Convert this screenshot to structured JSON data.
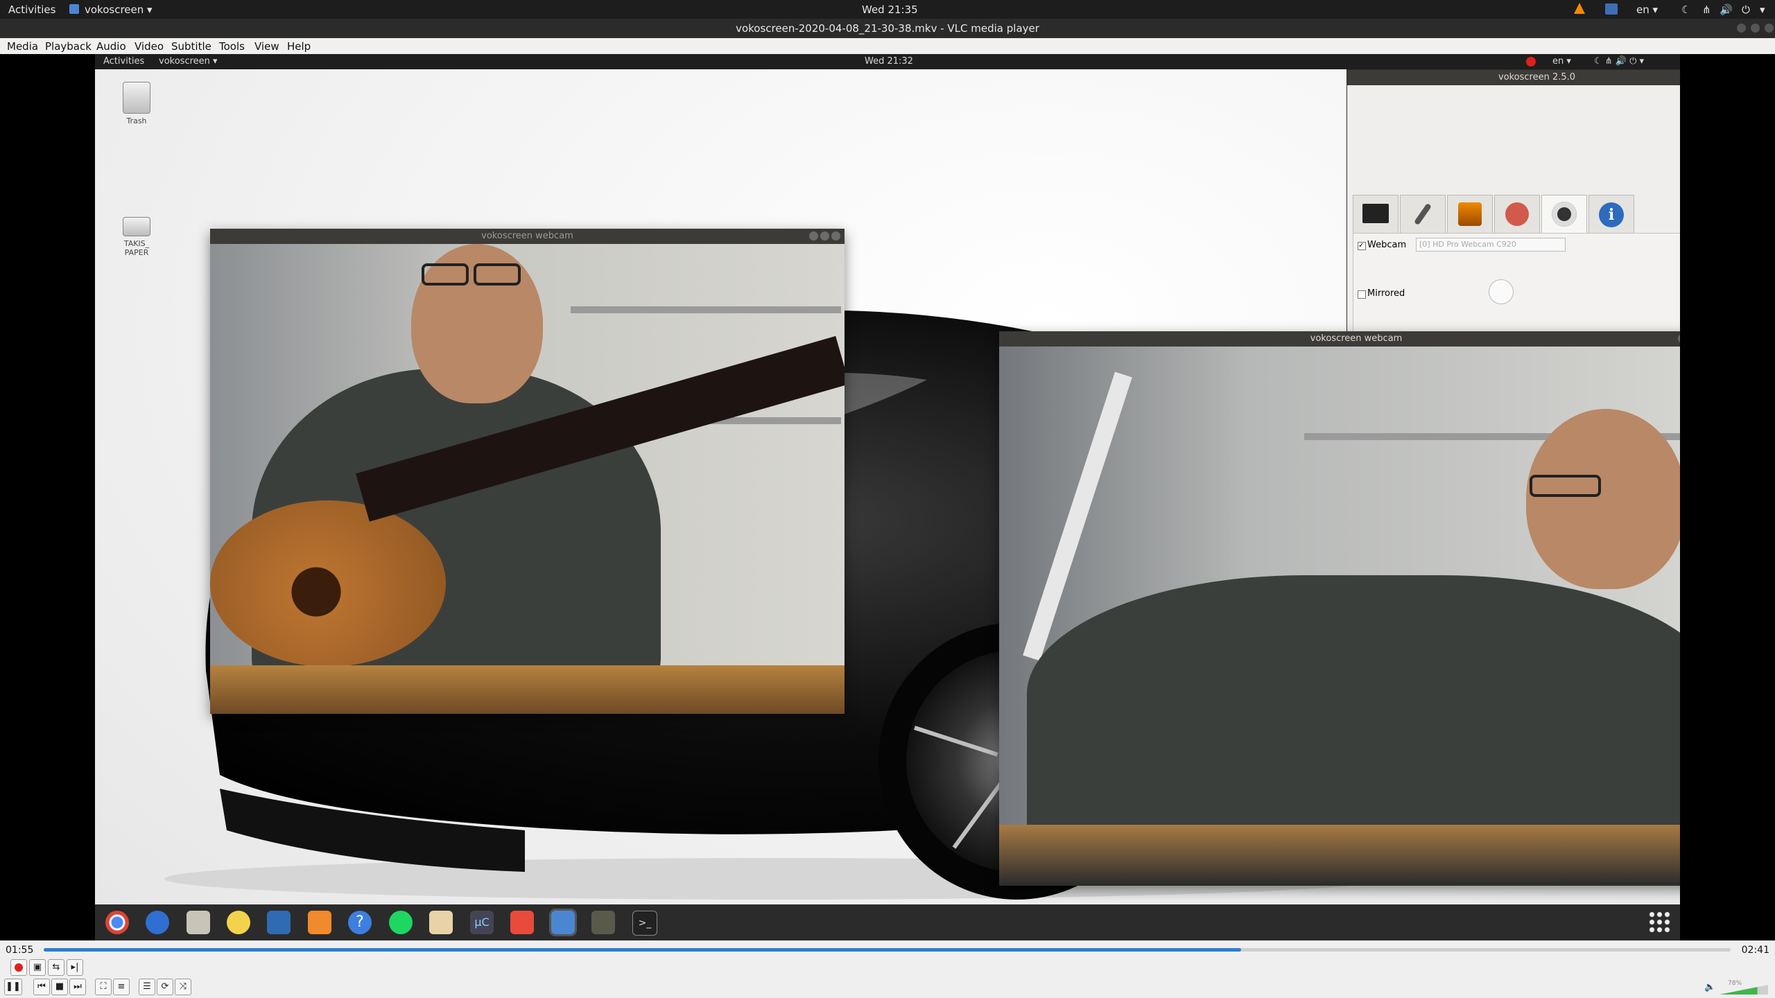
{
  "host_topbar": {
    "activities": "Activities",
    "app_menu": "vokoscreen ▾",
    "clock": "Wed 21:35",
    "lang": "en ▾"
  },
  "vlc": {
    "title": "vokoscreen-2020-04-08_21-30-38.mkv - VLC media player",
    "menu": [
      "Media",
      "Playback",
      "Audio",
      "Video",
      "Subtitle",
      "Tools",
      "View",
      "Help"
    ],
    "time_elapsed": "01:55",
    "time_total": "02:41",
    "progress": 0.71,
    "volume": "78%",
    "volume_level": 0.78
  },
  "recorded": {
    "topbar": {
      "activities": "Activities",
      "app_menu": "vokoscreen ▾",
      "clock": "Wed 21:32",
      "lang": "en ▾"
    },
    "desktop_icons": [
      "Trash",
      "TAKIS_\nPAPER"
    ],
    "webcam_small_title": "vokoscreen webcam",
    "webcam_large_title": "vokoscreen webcam",
    "voko": {
      "title": "vokoscreen 2.5.0",
      "webcam_label": "Webcam",
      "webcam_device": "[0] HD Pro Webcam C920",
      "mirrored_label": "Mirrored"
    }
  },
  "colors": {
    "accent": "#2a7fd4",
    "close": "#e2572b",
    "record": "#e0201b"
  },
  "icons": [
    "chrome-icon",
    "thunderbird-icon",
    "files-icon",
    "rhythmbox-icon",
    "writer-icon",
    "software-icon",
    "help-icon",
    "spotify-icon",
    "paper-icon",
    "mu-icon",
    "draw-icon",
    "vokoscreen-icon",
    "gimp-icon",
    "terminal-icon",
    "apps-grid-icon"
  ]
}
